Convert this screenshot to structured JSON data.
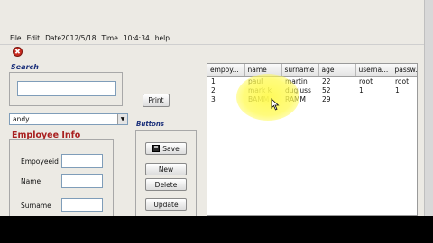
{
  "menu": {
    "file": "File",
    "edit": "Edit",
    "date_label": "Date2012/5/18",
    "time_label": "Time",
    "time_value": "10:4:34",
    "help": "help"
  },
  "toolbar": {
    "close_glyph": "✖"
  },
  "search": {
    "label": "Search",
    "value": ""
  },
  "print_label": "Print",
  "combo": {
    "selected": "andy",
    "arrow": "▼"
  },
  "employee_info": {
    "title": "Employee Info",
    "fields": {
      "empid_label": "Empoyeeid",
      "name_label": "Name",
      "surname_label": "Surname"
    }
  },
  "buttons": {
    "group_label": "Buttons",
    "save": "Save",
    "new": "New",
    "delete": "Delete",
    "update": "Update"
  },
  "table": {
    "columns": [
      "empoy...",
      "name",
      "surname",
      "age",
      "userna...",
      "passw..."
    ],
    "rows": [
      [
        "1",
        "paul",
        "martin",
        "22",
        "root",
        "root"
      ],
      [
        "2",
        "mark k",
        "dugluss",
        "52",
        "1",
        "1"
      ],
      [
        "3",
        "BAMM",
        "RAMM",
        "29",
        "",
        ""
      ]
    ]
  },
  "colors": {
    "window_bg": "#eceae4",
    "section_title": "#a82020",
    "group_label": "#1a2f7a",
    "highlight": "#fffa50"
  }
}
